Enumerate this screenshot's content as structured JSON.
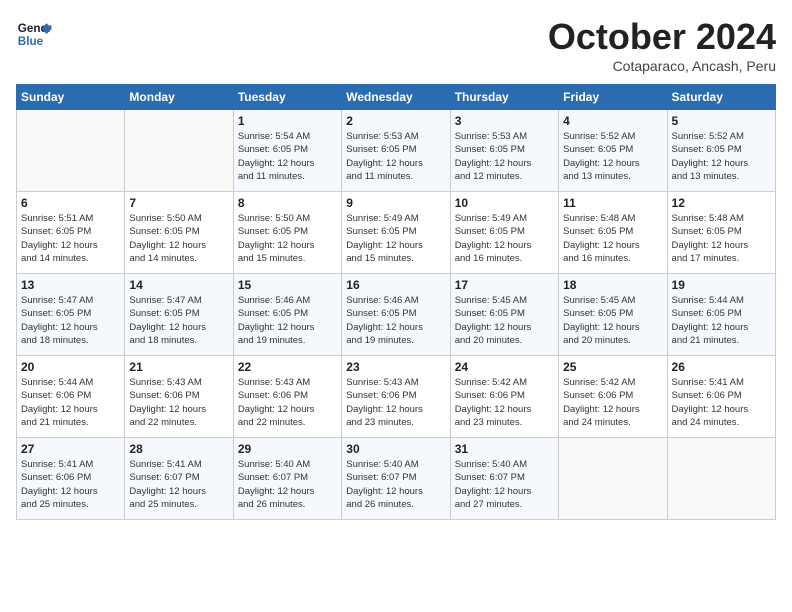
{
  "header": {
    "logo_line1": "General",
    "logo_line2": "Blue",
    "title": "October 2024",
    "subtitle": "Cotaparaco, Ancash, Peru"
  },
  "days_of_week": [
    "Sunday",
    "Monday",
    "Tuesday",
    "Wednesday",
    "Thursday",
    "Friday",
    "Saturday"
  ],
  "weeks": [
    [
      {
        "day": "",
        "info": ""
      },
      {
        "day": "",
        "info": ""
      },
      {
        "day": "1",
        "info": "Sunrise: 5:54 AM\nSunset: 6:05 PM\nDaylight: 12 hours\nand 11 minutes."
      },
      {
        "day": "2",
        "info": "Sunrise: 5:53 AM\nSunset: 6:05 PM\nDaylight: 12 hours\nand 11 minutes."
      },
      {
        "day": "3",
        "info": "Sunrise: 5:53 AM\nSunset: 6:05 PM\nDaylight: 12 hours\nand 12 minutes."
      },
      {
        "day": "4",
        "info": "Sunrise: 5:52 AM\nSunset: 6:05 PM\nDaylight: 12 hours\nand 13 minutes."
      },
      {
        "day": "5",
        "info": "Sunrise: 5:52 AM\nSunset: 6:05 PM\nDaylight: 12 hours\nand 13 minutes."
      }
    ],
    [
      {
        "day": "6",
        "info": "Sunrise: 5:51 AM\nSunset: 6:05 PM\nDaylight: 12 hours\nand 14 minutes."
      },
      {
        "day": "7",
        "info": "Sunrise: 5:50 AM\nSunset: 6:05 PM\nDaylight: 12 hours\nand 14 minutes."
      },
      {
        "day": "8",
        "info": "Sunrise: 5:50 AM\nSunset: 6:05 PM\nDaylight: 12 hours\nand 15 minutes."
      },
      {
        "day": "9",
        "info": "Sunrise: 5:49 AM\nSunset: 6:05 PM\nDaylight: 12 hours\nand 15 minutes."
      },
      {
        "day": "10",
        "info": "Sunrise: 5:49 AM\nSunset: 6:05 PM\nDaylight: 12 hours\nand 16 minutes."
      },
      {
        "day": "11",
        "info": "Sunrise: 5:48 AM\nSunset: 6:05 PM\nDaylight: 12 hours\nand 16 minutes."
      },
      {
        "day": "12",
        "info": "Sunrise: 5:48 AM\nSunset: 6:05 PM\nDaylight: 12 hours\nand 17 minutes."
      }
    ],
    [
      {
        "day": "13",
        "info": "Sunrise: 5:47 AM\nSunset: 6:05 PM\nDaylight: 12 hours\nand 18 minutes."
      },
      {
        "day": "14",
        "info": "Sunrise: 5:47 AM\nSunset: 6:05 PM\nDaylight: 12 hours\nand 18 minutes."
      },
      {
        "day": "15",
        "info": "Sunrise: 5:46 AM\nSunset: 6:05 PM\nDaylight: 12 hours\nand 19 minutes."
      },
      {
        "day": "16",
        "info": "Sunrise: 5:46 AM\nSunset: 6:05 PM\nDaylight: 12 hours\nand 19 minutes."
      },
      {
        "day": "17",
        "info": "Sunrise: 5:45 AM\nSunset: 6:05 PM\nDaylight: 12 hours\nand 20 minutes."
      },
      {
        "day": "18",
        "info": "Sunrise: 5:45 AM\nSunset: 6:05 PM\nDaylight: 12 hours\nand 20 minutes."
      },
      {
        "day": "19",
        "info": "Sunrise: 5:44 AM\nSunset: 6:05 PM\nDaylight: 12 hours\nand 21 minutes."
      }
    ],
    [
      {
        "day": "20",
        "info": "Sunrise: 5:44 AM\nSunset: 6:06 PM\nDaylight: 12 hours\nand 21 minutes."
      },
      {
        "day": "21",
        "info": "Sunrise: 5:43 AM\nSunset: 6:06 PM\nDaylight: 12 hours\nand 22 minutes."
      },
      {
        "day": "22",
        "info": "Sunrise: 5:43 AM\nSunset: 6:06 PM\nDaylight: 12 hours\nand 22 minutes."
      },
      {
        "day": "23",
        "info": "Sunrise: 5:43 AM\nSunset: 6:06 PM\nDaylight: 12 hours\nand 23 minutes."
      },
      {
        "day": "24",
        "info": "Sunrise: 5:42 AM\nSunset: 6:06 PM\nDaylight: 12 hours\nand 23 minutes."
      },
      {
        "day": "25",
        "info": "Sunrise: 5:42 AM\nSunset: 6:06 PM\nDaylight: 12 hours\nand 24 minutes."
      },
      {
        "day": "26",
        "info": "Sunrise: 5:41 AM\nSunset: 6:06 PM\nDaylight: 12 hours\nand 24 minutes."
      }
    ],
    [
      {
        "day": "27",
        "info": "Sunrise: 5:41 AM\nSunset: 6:06 PM\nDaylight: 12 hours\nand 25 minutes."
      },
      {
        "day": "28",
        "info": "Sunrise: 5:41 AM\nSunset: 6:07 PM\nDaylight: 12 hours\nand 25 minutes."
      },
      {
        "day": "29",
        "info": "Sunrise: 5:40 AM\nSunset: 6:07 PM\nDaylight: 12 hours\nand 26 minutes."
      },
      {
        "day": "30",
        "info": "Sunrise: 5:40 AM\nSunset: 6:07 PM\nDaylight: 12 hours\nand 26 minutes."
      },
      {
        "day": "31",
        "info": "Sunrise: 5:40 AM\nSunset: 6:07 PM\nDaylight: 12 hours\nand 27 minutes."
      },
      {
        "day": "",
        "info": ""
      },
      {
        "day": "",
        "info": ""
      }
    ]
  ]
}
